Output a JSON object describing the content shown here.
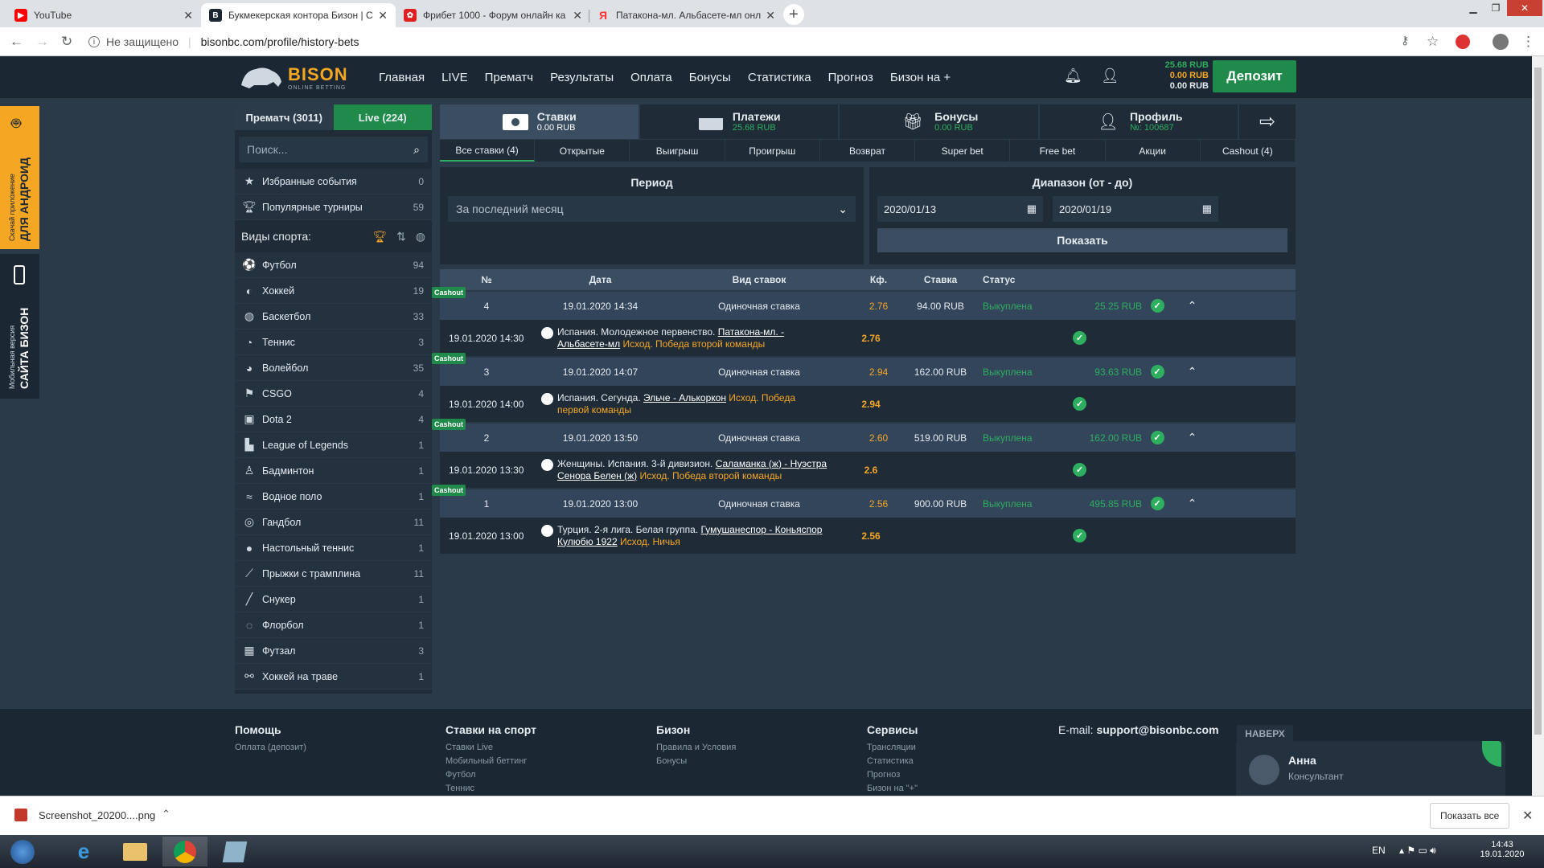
{
  "browser": {
    "tabs": [
      {
        "title": "YouTube",
        "fav": "youtube-icon",
        "fav_color": "#ff0000"
      },
      {
        "title": "Букмекерская контора Бизон | С",
        "fav": "bison-icon",
        "fav_color": "#1b2733"
      },
      {
        "title": "Фрибет 1000 - Форум онлайн ка",
        "fav": "forum-icon",
        "fav_color": "#e02020"
      },
      {
        "title": "Патакона-мл. Альбасете-мл онл",
        "fav": "yandex-icon",
        "fav_color": "#ff3333"
      }
    ],
    "security": "Не защищено",
    "url": "bisonbc.com/profile/history-bets"
  },
  "header": {
    "logo_text": "BISON",
    "logo_sub": "ONLINE BETTING",
    "menu": [
      "Главная",
      "LIVE",
      "Прематч",
      "Результаты",
      "Оплата",
      "Бонусы",
      "Статистика",
      "Прогноз",
      "Бизон на +"
    ],
    "balance_main": "25.68 RUB",
    "balance_bonus": "0.00 RUB",
    "balance_freebet": "0.00 RUB",
    "deposit": "Депозит"
  },
  "promo": {
    "android_small": "Скачай приложение",
    "android_big": "ДЛЯ АНДРОИД",
    "mobile_small": "Мобильная версия",
    "mobile_big": "САЙТА БИЗОН"
  },
  "sidebar": {
    "tab_prematch": "Прематч (3011)",
    "tab_live": "Live (224)",
    "search_placeholder": "Поиск...",
    "favorites": {
      "label": "Избранные события",
      "count": "0"
    },
    "popular": {
      "label": "Популярные турниры",
      "count": "59"
    },
    "sports_title": "Виды спорта:",
    "sports": [
      {
        "name": "Футбол",
        "count": "94",
        "icon": "⚽"
      },
      {
        "name": "Хоккей",
        "count": "19",
        "icon": "◐"
      },
      {
        "name": "Баскетбол",
        "count": "33",
        "icon": "◍"
      },
      {
        "name": "Теннис",
        "count": "3",
        "icon": "◔"
      },
      {
        "name": "Волейбол",
        "count": "35",
        "icon": "◕"
      },
      {
        "name": "CSGO",
        "count": "4",
        "icon": "⚑"
      },
      {
        "name": "Dota 2",
        "count": "4",
        "icon": "▣"
      },
      {
        "name": "League of Legends",
        "count": "1",
        "icon": "▙"
      },
      {
        "name": "Бадминтон",
        "count": "1",
        "icon": "♙"
      },
      {
        "name": "Водное поло",
        "count": "1",
        "icon": "≈"
      },
      {
        "name": "Гандбол",
        "count": "11",
        "icon": "◎"
      },
      {
        "name": "Настольный теннис",
        "count": "1",
        "icon": "●"
      },
      {
        "name": "Прыжки с трамплина",
        "count": "11",
        "icon": "⟋"
      },
      {
        "name": "Снукер",
        "count": "1",
        "icon": "╱"
      },
      {
        "name": "Флорбол",
        "count": "1",
        "icon": "◌"
      },
      {
        "name": "Футзал",
        "count": "3",
        "icon": "▦"
      },
      {
        "name": "Хоккей на траве",
        "count": "1",
        "icon": "⚯"
      }
    ]
  },
  "categories": [
    {
      "title": "Ставки",
      "sub": "0.00 RUB",
      "icon": "money-icon"
    },
    {
      "title": "Платежи",
      "sub": "25.68 RUB",
      "icon": "card-icon"
    },
    {
      "title": "Бонусы",
      "sub": "0.00 RUB",
      "icon": "gift-icon"
    },
    {
      "title": "Профиль",
      "sub": "№: 100687",
      "icon": "user-icon"
    }
  ],
  "subtabs": [
    "Все ставки (4)",
    "Открытые",
    "Выигрыш",
    "Проигрыш",
    "Возврат",
    "Super bet",
    "Free bet",
    "Акции",
    "Cashout (4)"
  ],
  "filter": {
    "period_title": "Период",
    "period_value": "За последний месяц",
    "range_title": "Диапазон (от - до)",
    "date_from": "2020/01/13",
    "date_to": "2020/01/19",
    "show": "Показать"
  },
  "table": {
    "headers": [
      "№",
      "Дата",
      "Вид ставок",
      "Кф.",
      "Ставка",
      "Статус"
    ],
    "bets": [
      {
        "num": "4",
        "date": "19.01.2020 14:34",
        "type": "Одиночная ставка",
        "coef": "2.76",
        "stake": "94.00 RUB",
        "status": "Выкуплена",
        "payout": "25.25 RUB",
        "badge": "Cashout",
        "ev_date": "19.01.2020 14:30",
        "ev_league": "Испания. Молодежное первенство.",
        "ev_match": "Патакона-мл. - Альбасете-мл",
        "ev_outcome": "Исход. Победа второй команды",
        "ev_coef": "2.76"
      },
      {
        "num": "3",
        "date": "19.01.2020 14:07",
        "type": "Одиночная ставка",
        "coef": "2.94",
        "stake": "162.00 RUB",
        "status": "Выкуплена",
        "payout": "93.63 RUB",
        "badge": "Cashout",
        "ev_date": "19.01.2020 14:00",
        "ev_league": "Испания. Сегунда.",
        "ev_match": "Эльче - Алькоркон",
        "ev_outcome": "Исход. Победа первой команды",
        "ev_coef": "2.94"
      },
      {
        "num": "2",
        "date": "19.01.2020 13:50",
        "type": "Одиночная ставка",
        "coef": "2.60",
        "stake": "519.00 RUB",
        "status": "Выкуплена",
        "payout": "162.00 RUB",
        "badge": "Cashout",
        "ev_date": "19.01.2020 13:30",
        "ev_league": "Женщины. Испания. 3-й дивизион.",
        "ev_match": "Саламанка (ж) - Нуэстра Сенора Белен (ж)",
        "ev_outcome": "Исход. Победа второй команды",
        "ev_coef": "2.6"
      },
      {
        "num": "1",
        "date": "19.01.2020 13:00",
        "type": "Одиночная ставка",
        "coef": "2.56",
        "stake": "900.00 RUB",
        "status": "Выкуплена",
        "payout": "495.85 RUB",
        "badge": "Cashout",
        "ev_date": "19.01.2020 13:00",
        "ev_league": "Турция. 2-я лига. Белая группа.",
        "ev_match": "Гумушанеспор - Коньяспор Кулюбю 1922",
        "ev_outcome": "Исход. Ничья",
        "ev_coef": "2.56"
      }
    ]
  },
  "footer": {
    "cols": [
      {
        "title": "Помощь",
        "items": [
          "Оплата (депозит)"
        ]
      },
      {
        "title": "Ставки на спорт",
        "items": [
          "Ставки Live",
          "Мобильный беттинг",
          "Футбол",
          "Теннис"
        ]
      },
      {
        "title": "Бизон",
        "items": [
          "Правила и Условия",
          "Бонусы"
        ]
      },
      {
        "title": "Сервисы",
        "items": [
          "Трансляции",
          "Статистика",
          "Прогноз",
          "Бизон на \"+\""
        ]
      }
    ],
    "email_label": "E-mail:",
    "email": "support@bisonbc.com",
    "to_top": "НАВЕРХ",
    "chat_name": "Анна",
    "chat_role": "Консультант"
  },
  "downloads": {
    "file": "Screenshot_20200....png",
    "show_all": "Показать все"
  },
  "taskbar": {
    "lang": "EN",
    "time": "14:43",
    "date": "19.01.2020"
  }
}
